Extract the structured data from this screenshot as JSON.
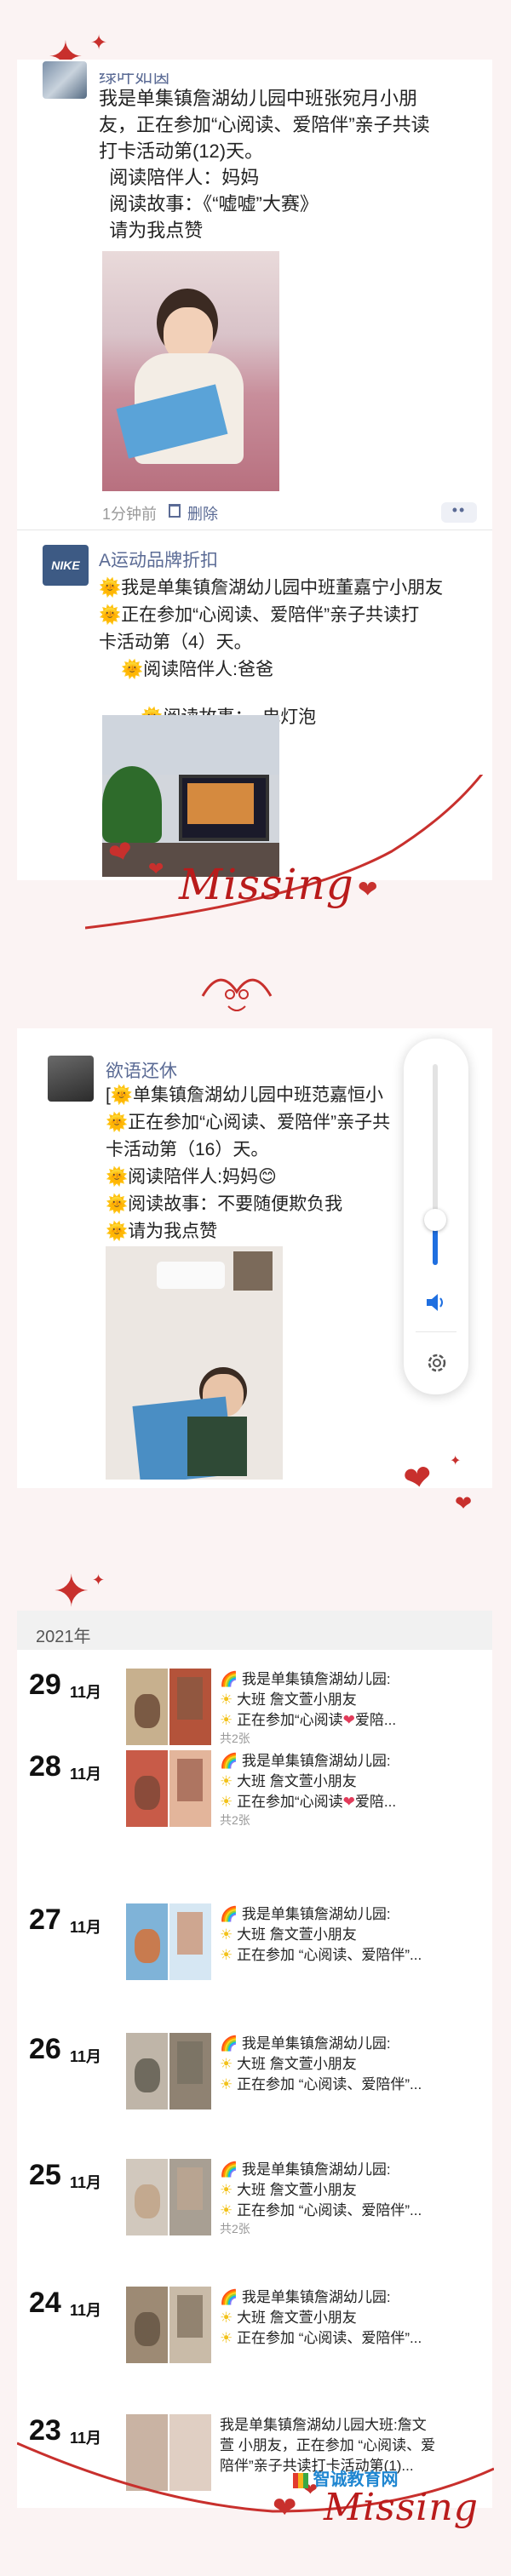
{
  "post1": {
    "username": "绿叶如茵",
    "lines": [
      "我是单集镇詹湖幼儿园中班张宛月小朋",
      "友，正在参加“心阅读、爱陪伴”亲子共读",
      "打卡活动第(12)天。",
      "  阅读陪伴人：妈妈",
      "  阅读故事：《“嘘嘘”大赛》",
      "  请为我点赞"
    ],
    "time": "1分钟前",
    "delete": "删除",
    "more": "••"
  },
  "post2": {
    "username": "A运动品牌折扣",
    "avatar_text": "NIKE",
    "lines": [
      "正在参加“心阅读、爱陪伴”亲子共读打",
      "卡活动第（4）天。",
      "阅读陪伴人:爸爸",
      "阅读故事：  电灯泡"
    ],
    "line1": "我是单集镇詹湖幼儿园中班董嘉宁小朋友"
  },
  "post3": {
    "username": "欲语还休",
    "line1": "单集镇詹湖幼儿园中班范嘉恒小",
    "line2": "正在参加“心阅读、爱陪伴”亲子共",
    "line3": "卡活动第（16）天。",
    "line4": "阅读陪伴人:妈妈",
    "line5": "阅读故事：不要随便欺负我",
    "line6": "请为我点赞"
  },
  "missing_text": "Missing",
  "year": "2021年",
  "timeline": [
    {
      "day": "29",
      "month": "11月",
      "l1": "我是单集镇詹湖幼儿园:",
      "l2": "大班  詹文萱小朋友",
      "l3": "正在参加“心阅读",
      "l3b": "爱陪...",
      "count": "共2张"
    },
    {
      "day": "28",
      "month": "11月",
      "l1": "我是单集镇詹湖幼儿园:",
      "l2": "大班  詹文萱小朋友",
      "l3": "正在参加“心阅读",
      "l3b": "爱陪...",
      "count": "共2张"
    },
    {
      "day": "27",
      "month": "11月",
      "l1": "我是单集镇詹湖幼儿园:",
      "l2": "大班  詹文萱小朋友",
      "l3": "正在参加 “心阅读、爱陪伴”...",
      "count": ""
    },
    {
      "day": "26",
      "month": "11月",
      "l1": "我是单集镇詹湖幼儿园:",
      "l2": "大班  詹文萱小朋友",
      "l3": "正在参加 “心阅读、爱陪伴”...",
      "count": ""
    },
    {
      "day": "25",
      "month": "11月",
      "l1": "我是单集镇詹湖幼儿园:",
      "l2": "大班  詹文萱小朋友",
      "l3": "正在参加 “心阅读、爱陪伴”...",
      "count": "共2张"
    },
    {
      "day": "24",
      "month": "11月",
      "l1": "我是单集镇詹湖幼儿园:",
      "l2": "大班  詹文萱小朋友",
      "l3": "正在参加 “心阅读、爱陪伴”...",
      "count": ""
    },
    {
      "day": "23",
      "month": "11月",
      "l1": "我是单集镇詹湖幼儿园大班:詹文",
      "l2": "萱  小朋友，正在参加 “心阅读、爱",
      "l3": "陪伴”亲子共读打卡活动第(1)...",
      "count": ""
    }
  ],
  "watermark": "智诚教育网",
  "colors": {
    "accent": "#c8302d",
    "link": "#5b6b95",
    "slider": "#1f6fe0"
  }
}
